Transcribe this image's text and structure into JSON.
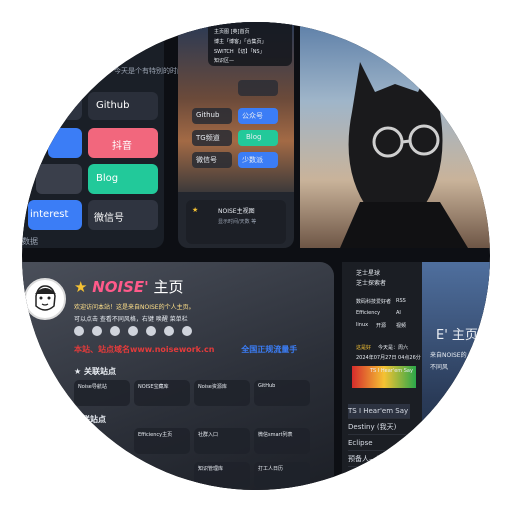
{
  "top_left": {
    "notice": "今天是个有特别的时间。",
    "tiles": {
      "github": "Github",
      "douyin": "抖音",
      "blog": "Blog",
      "pinterest": "interest",
      "wechat": "微信号",
      "footer": "数据"
    }
  },
  "top_middle": {
    "menu": [
      "主页图 [英]首页",
      "博主「博客」「合集页」",
      "SWITCH 【切】「NS」",
      "知识区—"
    ],
    "links": {
      "github": "Github",
      "public": "公众号",
      "tg": "TG频道",
      "blog": "Blog",
      "wechat": "微信号",
      "shao": "少数派"
    },
    "footer_title": "NOISE主视图",
    "footer_sub": "显示时间/天数 等"
  },
  "bottom_left": {
    "title_star": "★",
    "title_brand": "NOISE'",
    "title_home": "主页",
    "welcome": "欢迎访问本站！这是来自NOISE的个人主页。",
    "hint": "可以点击 查看不同风格，右键 唤醒 菜单栏",
    "marquee": "本站、站点域名www.noisework.cn",
    "marquee_extra": "全国正规流量手",
    "section1": "★ 关联站点",
    "section2": "关联站点",
    "cards_row1": [
      "Noise导航站",
      "NOISE宝藏库",
      "Noise资源库",
      "GitHub"
    ],
    "cards_row2": [
      "",
      "Efficiency主页",
      "社群入口",
      "微信smart列表"
    ],
    "cards_row3": [
      "",
      "",
      "知识管理库",
      "打工人日历"
    ]
  },
  "bottom_right": {
    "sidebar_top": [
      "芝士星球",
      "芝士探索者"
    ],
    "tags": [
      "数码科技爱好者",
      "RSS",
      "Efficiency",
      "AI",
      "linux",
      "开源",
      "视频"
    ],
    "date_label": "这是好",
    "date_weekday": "今天是：周六",
    "date_value": "2024年07月27日 04点26分",
    "player_title": "TS I Hear'em Say",
    "tracks": [
      "TS I Hear'em Say",
      "Destiny (我天)",
      "Eclipse",
      "预备人—晨叮"
    ],
    "brand_partial": "E' 主页",
    "noise_partial": "来自NOISE的",
    "noise_partial2": "不同风"
  },
  "colors": {
    "blue_tile": "#3b7df6",
    "pink_tile": "#f2677d",
    "green_tile": "#22c99a",
    "gold": "#f5c233",
    "red": "#e33b3b"
  }
}
